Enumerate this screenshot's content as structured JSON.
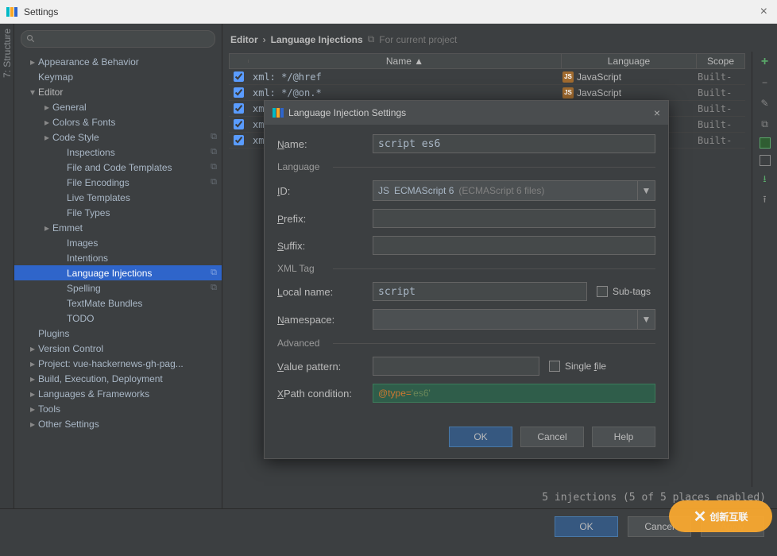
{
  "window": {
    "title": "Settings"
  },
  "search": {
    "placeholder": ""
  },
  "gutter": {
    "label": "7: Structure"
  },
  "sidebar": {
    "items": [
      {
        "label": "Appearance & Behavior",
        "level": 0,
        "arrow": "▸"
      },
      {
        "label": "Keymap",
        "level": 0,
        "arrow": ""
      },
      {
        "label": "Editor",
        "level": 0,
        "arrow": "▾",
        "bold": true
      },
      {
        "label": "General",
        "level": 1,
        "arrow": "▸"
      },
      {
        "label": "Colors & Fonts",
        "level": 1,
        "arrow": "▸"
      },
      {
        "label": "Code Style",
        "level": 1,
        "arrow": "▸",
        "copy": true
      },
      {
        "label": "Inspections",
        "level": 2,
        "arrow": "",
        "copy": true
      },
      {
        "label": "File and Code Templates",
        "level": 2,
        "arrow": "",
        "copy": true
      },
      {
        "label": "File Encodings",
        "level": 2,
        "arrow": "",
        "copy": true
      },
      {
        "label": "Live Templates",
        "level": 2,
        "arrow": ""
      },
      {
        "label": "File Types",
        "level": 2,
        "arrow": ""
      },
      {
        "label": "Emmet",
        "level": 1,
        "arrow": "▸"
      },
      {
        "label": "Images",
        "level": 2,
        "arrow": ""
      },
      {
        "label": "Intentions",
        "level": 2,
        "arrow": ""
      },
      {
        "label": "Language Injections",
        "level": 2,
        "arrow": "",
        "selected": true,
        "copy": true
      },
      {
        "label": "Spelling",
        "level": 2,
        "arrow": "",
        "copy": true
      },
      {
        "label": "TextMate Bundles",
        "level": 2,
        "arrow": ""
      },
      {
        "label": "TODO",
        "level": 2,
        "arrow": ""
      },
      {
        "label": "Plugins",
        "level": 0,
        "arrow": ""
      },
      {
        "label": "Version Control",
        "level": 0,
        "arrow": "▸"
      },
      {
        "label": "Project: vue-hackernews-gh-pag...",
        "level": 0,
        "arrow": "▸"
      },
      {
        "label": "Build, Execution, Deployment",
        "level": 0,
        "arrow": "▸"
      },
      {
        "label": "Languages & Frameworks",
        "level": 0,
        "arrow": "▸"
      },
      {
        "label": "Tools",
        "level": 0,
        "arrow": "▸"
      },
      {
        "label": "Other Settings",
        "level": 0,
        "arrow": "▸"
      }
    ]
  },
  "breadcrumb": {
    "a": "Editor",
    "sep": "›",
    "b": "Language Injections",
    "note": "For current project"
  },
  "table": {
    "head": {
      "name": "Name ▲",
      "lang": "Language",
      "scope": "Scope"
    },
    "rows": [
      {
        "name": "xml: */@href",
        "lang": "JavaScript",
        "scope": "Built-"
      },
      {
        "name": "xml: */@on.*",
        "lang": "JavaScript",
        "scope": "Built-"
      },
      {
        "name": "xm",
        "lang": "",
        "scope": "Built-"
      },
      {
        "name": "xm",
        "lang": "",
        "scope": "Built-"
      },
      {
        "name": "xm",
        "lang": "",
        "scope": "Built-"
      }
    ]
  },
  "status": "5 injections (5 of 5 places enabled)",
  "buttons": {
    "ok": "OK",
    "cancel": "Cancel",
    "apply": "Apply"
  },
  "modal": {
    "title": "Language Injection Settings",
    "name_label": "Name:",
    "name_value": "script es6",
    "lang_legend": "Language",
    "id_label": "ID:",
    "id_value": "ECMAScript 6",
    "id_hint": "(ECMAScript 6 files)",
    "prefix_label": "Prefix:",
    "prefix_value": "",
    "suffix_label": "Suffix:",
    "suffix_value": "",
    "xml_legend": "XML Tag",
    "local_label": "Local name:",
    "local_value": "script",
    "subtags_label": "Sub-tags",
    "ns_label": "Namespace:",
    "adv_legend": "Advanced",
    "vp_label": "Value pattern:",
    "vp_value": "",
    "single_label": "Single file",
    "xpath_label": "XPath condition:",
    "xpath_attr": "@type=",
    "xpath_val": "'es6'",
    "ok": "OK",
    "cancel": "Cancel",
    "help": "Help"
  },
  "watermark": "创新互联"
}
